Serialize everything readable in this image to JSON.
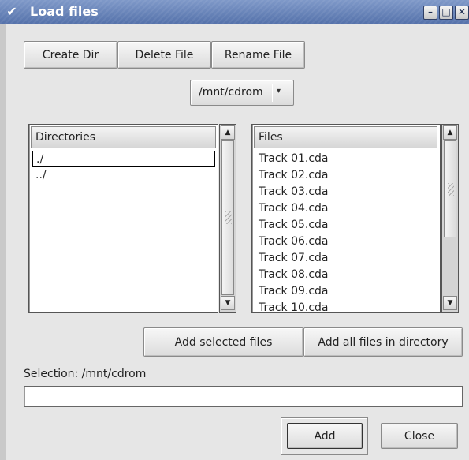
{
  "window": {
    "title": "Load files",
    "menu_icon": "✔",
    "controls": {
      "minimize": "–",
      "maximize": "□",
      "close": "✕"
    }
  },
  "toolbar": {
    "create_dir": "Create Dir",
    "delete_file": "Delete File",
    "rename_file": "Rename File"
  },
  "path_combo": {
    "value": "/mnt/cdrom",
    "arrow": "▾"
  },
  "directories": {
    "header": "Directories",
    "items": [
      "./",
      "../"
    ]
  },
  "files": {
    "header": "Files",
    "items": [
      "Track 01.cda",
      "Track 02.cda",
      "Track 03.cda",
      "Track 04.cda",
      "Track 05.cda",
      "Track 06.cda",
      "Track 07.cda",
      "Track 08.cda",
      "Track 09.cda",
      "Track 10.cda"
    ]
  },
  "scroll": {
    "up": "▲",
    "down": "▼"
  },
  "actions": {
    "add_selected": "Add selected files",
    "add_all": "Add all files in directory"
  },
  "selection": {
    "label": "Selection: /mnt/cdrom",
    "value": ""
  },
  "footer": {
    "add": "Add",
    "close": "Close"
  }
}
